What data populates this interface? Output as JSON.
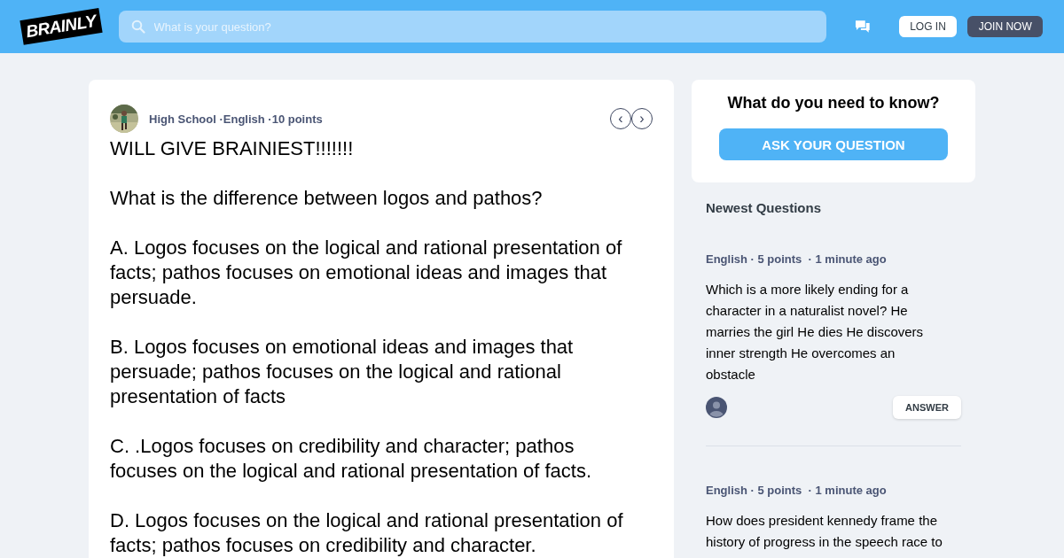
{
  "header": {
    "logo": "BRAINLY",
    "search": {
      "placeholder": "What is your question?"
    },
    "login": "LOG IN",
    "join": "JOIN NOW"
  },
  "question": {
    "meta": "High School ·English ·10 points",
    "paragraphs": [
      "WILL GIVE BRAINIEST!!!!!!!",
      "What is the difference between logos and pathos?",
      "A. Logos focuses on the logical and rational presentation of facts; pathos focuses on emotional ideas and images that persuade.",
      "B. Logos focuses on emotional ideas and images that persuade; pathos focuses on the logical and rational presentation of facts",
      "C. .Logos focuses on credibility and character; pathos focuses on the logical and rational presentation of facts.",
      "D. Logos focuses on the logical and rational presentation of facts; pathos focuses on credibility and character."
    ],
    "prev": "‹",
    "next": "›"
  },
  "ask": {
    "title": "What do you need to know?",
    "button": "ASK YOUR QUESTION"
  },
  "newest": {
    "title": "Newest Questions",
    "items": [
      {
        "meta": "English · 5 points  · 1 minute ago",
        "text": "Which is a more likely ending for a character in a naturalist novel? He marries the girl He dies He discovers inner strength He overcomes an obstacle",
        "answer": "ANSWER"
      },
      {
        "meta": "English · 5 points  · 1 minute ago",
        "text": "How does president kennedy frame the history of progress in the speech race to"
      }
    ]
  }
}
